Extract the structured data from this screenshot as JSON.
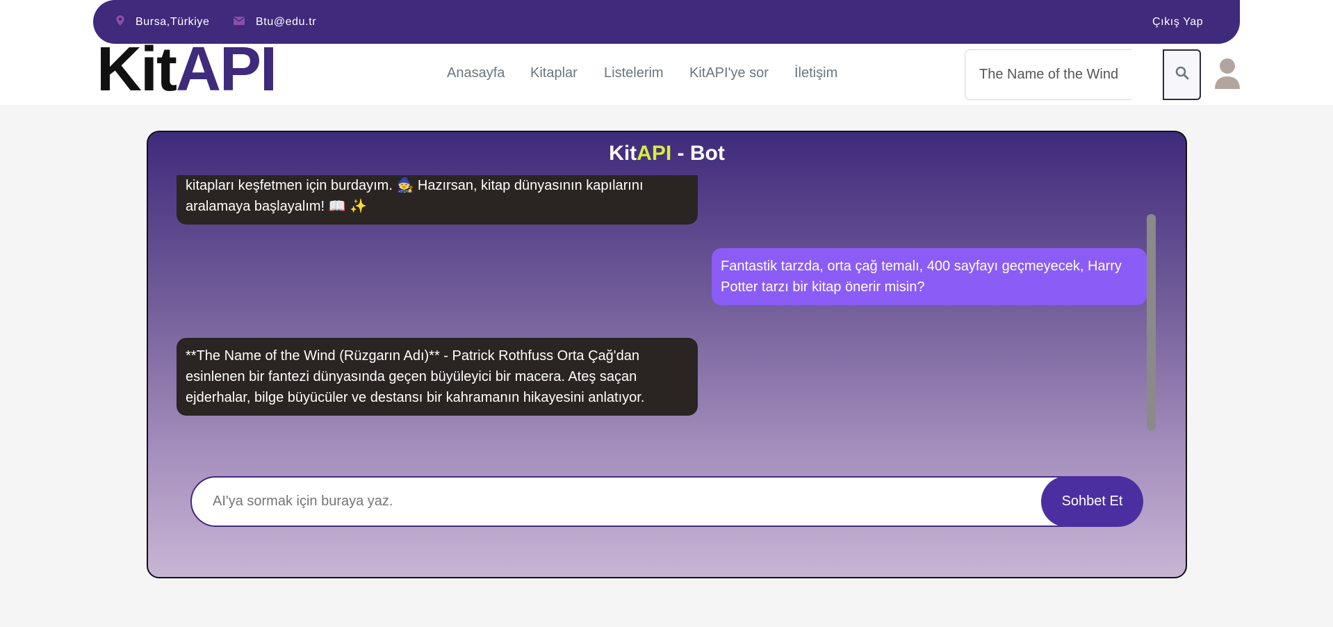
{
  "topbar": {
    "location": "Bursa,Türkiye",
    "email": "Btu@edu.tr",
    "logout": "Çıkış Yap",
    "location_icon": "map-pin-icon",
    "email_icon": "envelope-icon"
  },
  "brand": {
    "kit": "Kit",
    "api": "API"
  },
  "nav": {
    "items": [
      "Anasayfa",
      "Kitaplar",
      "Listelerim",
      "KitAPI'ye sor",
      "İletişim"
    ]
  },
  "search": {
    "value": "The Name of the Wind",
    "icon": "search-icon"
  },
  "user": {
    "icon": "user-icon"
  },
  "chat": {
    "title_kit": "Kit",
    "title_api": "API",
    "title_rest": " - Bot",
    "messages": [
      {
        "role": "bot",
        "text": "kitapları keşfetmen için burdayım. 🧙 Hazırsan, kitap dünyasının kapılarını aralamaya başlayalım! 📖 ✨"
      },
      {
        "role": "user",
        "text": "Fantastik tarzda, orta çağ temalı, 400 sayfayı geçmeyecek, Harry Potter tarzı bir kitap önerir misin?"
      },
      {
        "role": "bot",
        "text": "**The Name of the Wind (Rüzgarın Adı)** - Patrick Rothfuss Orta Çağ'dan esinlenen bir fantezi dünyasında geçen büyüleyici bir macera. Ateş saçan ejderhalar, bilge büyücüler ve destansı bir kahramanın hikayesini anlatıyor."
      }
    ],
    "input_placeholder": "AI'ya sormak için buraya yaz.",
    "send_label": "Sohbet Et"
  },
  "colors": {
    "brand": "#3f2a7c",
    "accent": "#d4f03a",
    "user_bubble": "#8b5cf6",
    "bot_bubble": "#2a2523"
  }
}
